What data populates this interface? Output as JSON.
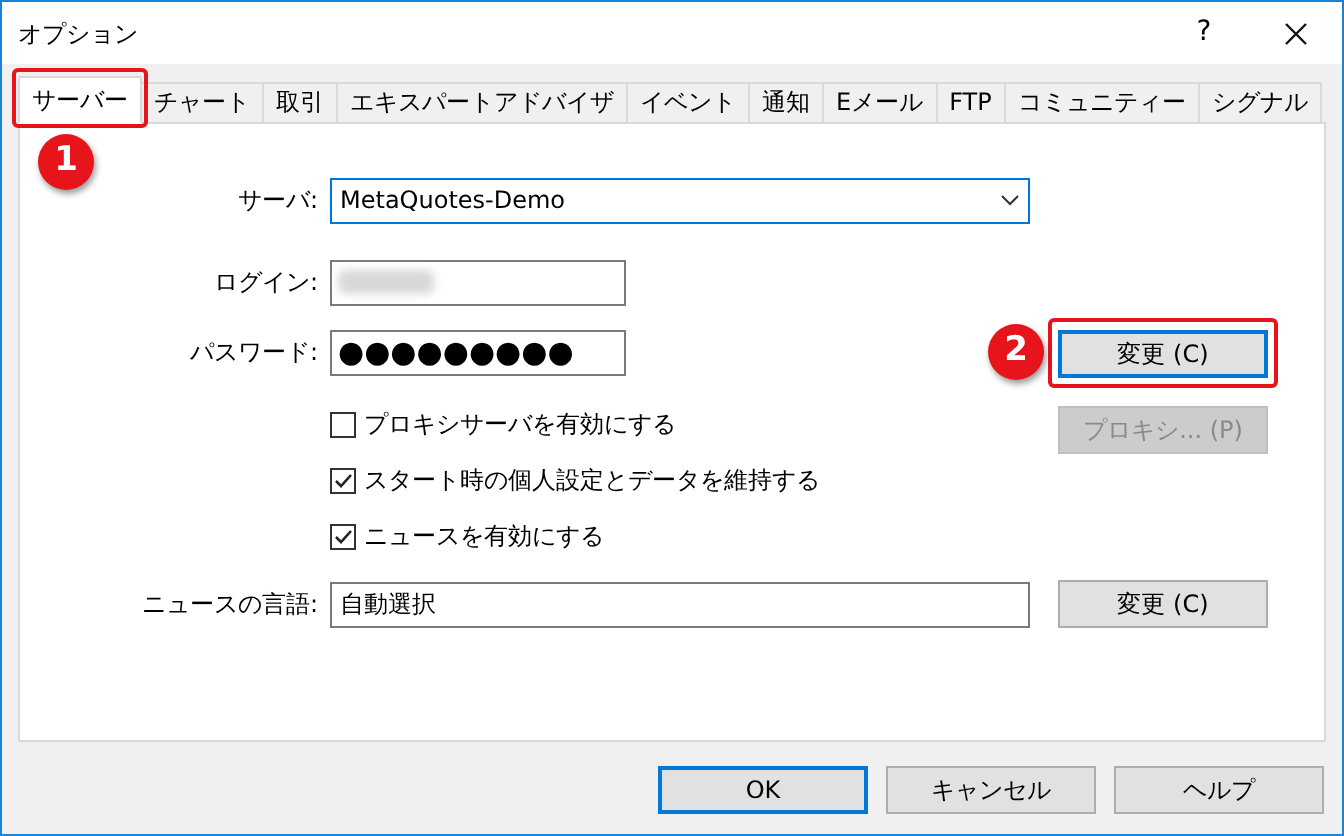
{
  "window": {
    "title": "オプション",
    "help": "?"
  },
  "tabs": [
    {
      "label": "サーバー",
      "selected": true,
      "callout": "1"
    },
    {
      "label": "チャート",
      "selected": false
    },
    {
      "label": "取引",
      "selected": false
    },
    {
      "label": "エキスパートアドバイザ",
      "selected": false
    },
    {
      "label": "イベント",
      "selected": false
    },
    {
      "label": "通知",
      "selected": false
    },
    {
      "label": "Eメール",
      "selected": false
    },
    {
      "label": "FTP",
      "selected": false
    },
    {
      "label": "コミュニティー",
      "selected": false
    },
    {
      "label": "シグナル",
      "selected": false
    }
  ],
  "server": {
    "label": "サーバ:",
    "value": "MetaQuotes-Demo"
  },
  "login": {
    "label": "ログイン:"
  },
  "password": {
    "label": "パスワード:",
    "value": "●●●●●●●●●"
  },
  "change_button": {
    "label": "変更 (C)",
    "callout": "2"
  },
  "checkboxes": [
    {
      "label": "プロキシサーバを有効にする",
      "checked": false
    },
    {
      "label": "スタート時の個人設定とデータを維持する",
      "checked": true
    },
    {
      "label": "ニュースを有効にする",
      "checked": true
    }
  ],
  "proxy_button": {
    "label": "プロキシ... (P)",
    "disabled": true
  },
  "news_language": {
    "label": "ニュースの言語:",
    "value": "自動選択",
    "button": "変更 (C)"
  },
  "footer_buttons": [
    {
      "label": "OK",
      "default": true
    },
    {
      "label": "キャンセル",
      "default": false
    },
    {
      "label": "ヘルプ",
      "default": false
    }
  ]
}
